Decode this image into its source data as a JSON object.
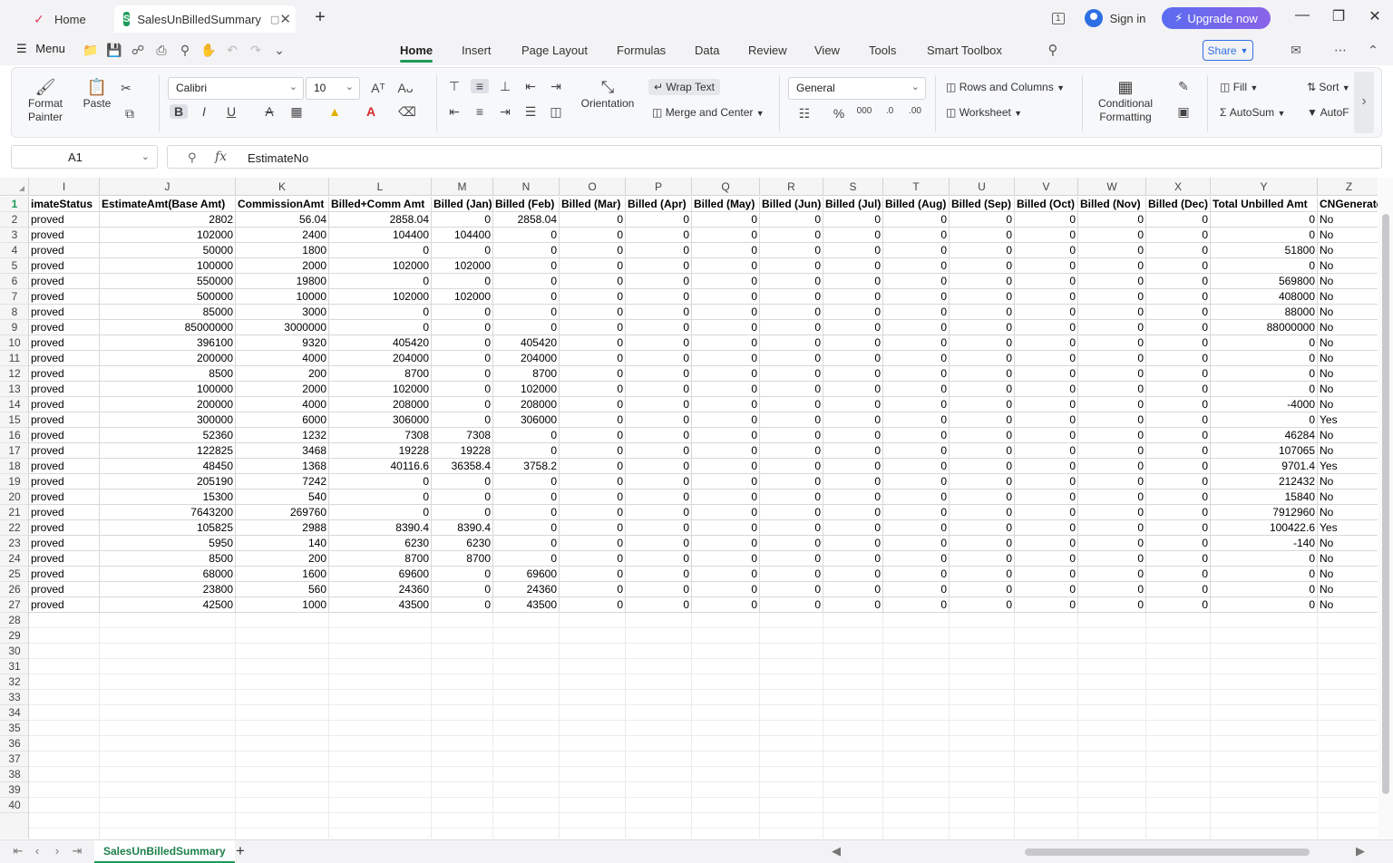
{
  "tabs": {
    "home_label": "Home",
    "doc_label": "SalesUnBilledSummary"
  },
  "titlebar": {
    "signin_label": "Sign in",
    "upgrade_label": "Upgrade now",
    "window_badge": "1"
  },
  "menubar": {
    "menu_label": "Menu",
    "ribbon_tabs": [
      "Home",
      "Insert",
      "Page Layout",
      "Formulas",
      "Data",
      "Review",
      "View",
      "Tools",
      "Smart Toolbox"
    ],
    "active_tab": "Home",
    "share_label": "Share"
  },
  "ribbon": {
    "format_painter": "Format Painter",
    "paste": "Paste",
    "font_name": "Calibri",
    "font_size": "10",
    "wrap_text": "Wrap Text",
    "orientation": "Orientation",
    "merge_center": "Merge and Center",
    "number_format": "General",
    "rows_columns": "Rows and Columns",
    "worksheet": "Worksheet",
    "conditional_formatting": "Conditional Formatting",
    "fill": "Fill",
    "sort": "Sort",
    "autosum": "AutoSum",
    "autofilter": "AutoF",
    "accent_color": "#1b9b58"
  },
  "formula_bar": {
    "cell_ref": "A1",
    "fx": "fx",
    "content": "EstimateNo"
  },
  "sheet": {
    "columns": [
      {
        "letter": "I",
        "header": "imateStatus",
        "type": "text"
      },
      {
        "letter": "J",
        "header": "EstimateAmt(Base Amt)",
        "type": "num"
      },
      {
        "letter": "K",
        "header": "CommissionAmt",
        "type": "num"
      },
      {
        "letter": "L",
        "header": "Billed+Comm Amt",
        "type": "num"
      },
      {
        "letter": "M",
        "header": "Billed (Jan)",
        "type": "num"
      },
      {
        "letter": "N",
        "header": "Billed (Feb)",
        "type": "num"
      },
      {
        "letter": "O",
        "header": "Billed (Mar)",
        "type": "num"
      },
      {
        "letter": "P",
        "header": "Billed (Apr)",
        "type": "num"
      },
      {
        "letter": "Q",
        "header": "Billed (May)",
        "type": "num"
      },
      {
        "letter": "R",
        "header": "Billed (Jun)",
        "type": "num"
      },
      {
        "letter": "S",
        "header": "Billed (Jul)",
        "type": "num"
      },
      {
        "letter": "T",
        "header": "Billed (Aug)",
        "type": "num"
      },
      {
        "letter": "U",
        "header": "Billed (Sep)",
        "type": "num"
      },
      {
        "letter": "V",
        "header": "Billed (Oct)",
        "type": "num"
      },
      {
        "letter": "W",
        "header": "Billed (Nov)",
        "type": "num"
      },
      {
        "letter": "X",
        "header": "Billed (Dec)",
        "type": "num"
      },
      {
        "letter": "Y",
        "header": "Total Unbilled Amt",
        "type": "num"
      },
      {
        "letter": "Z",
        "header": "CNGenerate",
        "type": "text"
      }
    ],
    "rows": [
      [
        "proved",
        "2802",
        "56.04",
        "2858.04",
        "0",
        "2858.04",
        "0",
        "0",
        "0",
        "0",
        "0",
        "0",
        "0",
        "0",
        "0",
        "0",
        "0",
        "No"
      ],
      [
        "proved",
        "102000",
        "2400",
        "104400",
        "104400",
        "0",
        "0",
        "0",
        "0",
        "0",
        "0",
        "0",
        "0",
        "0",
        "0",
        "0",
        "0",
        "No"
      ],
      [
        "proved",
        "50000",
        "1800",
        "0",
        "0",
        "0",
        "0",
        "0",
        "0",
        "0",
        "0",
        "0",
        "0",
        "0",
        "0",
        "0",
        "51800",
        "No"
      ],
      [
        "proved",
        "100000",
        "2000",
        "102000",
        "102000",
        "0",
        "0",
        "0",
        "0",
        "0",
        "0",
        "0",
        "0",
        "0",
        "0",
        "0",
        "0",
        "No"
      ],
      [
        "proved",
        "550000",
        "19800",
        "0",
        "0",
        "0",
        "0",
        "0",
        "0",
        "0",
        "0",
        "0",
        "0",
        "0",
        "0",
        "0",
        "569800",
        "No"
      ],
      [
        "proved",
        "500000",
        "10000",
        "102000",
        "102000",
        "0",
        "0",
        "0",
        "0",
        "0",
        "0",
        "0",
        "0",
        "0",
        "0",
        "0",
        "408000",
        "No"
      ],
      [
        "proved",
        "85000",
        "3000",
        "0",
        "0",
        "0",
        "0",
        "0",
        "0",
        "0",
        "0",
        "0",
        "0",
        "0",
        "0",
        "0",
        "88000",
        "No"
      ],
      [
        "proved",
        "85000000",
        "3000000",
        "0",
        "0",
        "0",
        "0",
        "0",
        "0",
        "0",
        "0",
        "0",
        "0",
        "0",
        "0",
        "0",
        "88000000",
        "No"
      ],
      [
        "proved",
        "396100",
        "9320",
        "405420",
        "0",
        "405420",
        "0",
        "0",
        "0",
        "0",
        "0",
        "0",
        "0",
        "0",
        "0",
        "0",
        "0",
        "No"
      ],
      [
        "proved",
        "200000",
        "4000",
        "204000",
        "0",
        "204000",
        "0",
        "0",
        "0",
        "0",
        "0",
        "0",
        "0",
        "0",
        "0",
        "0",
        "0",
        "No"
      ],
      [
        "proved",
        "8500",
        "200",
        "8700",
        "0",
        "8700",
        "0",
        "0",
        "0",
        "0",
        "0",
        "0",
        "0",
        "0",
        "0",
        "0",
        "0",
        "No"
      ],
      [
        "proved",
        "100000",
        "2000",
        "102000",
        "0",
        "102000",
        "0",
        "0",
        "0",
        "0",
        "0",
        "0",
        "0",
        "0",
        "0",
        "0",
        "0",
        "No"
      ],
      [
        "proved",
        "200000",
        "4000",
        "208000",
        "0",
        "208000",
        "0",
        "0",
        "0",
        "0",
        "0",
        "0",
        "0",
        "0",
        "0",
        "0",
        "-4000",
        "No"
      ],
      [
        "proved",
        "300000",
        "6000",
        "306000",
        "0",
        "306000",
        "0",
        "0",
        "0",
        "0",
        "0",
        "0",
        "0",
        "0",
        "0",
        "0",
        "0",
        "Yes"
      ],
      [
        "proved",
        "52360",
        "1232",
        "7308",
        "7308",
        "0",
        "0",
        "0",
        "0",
        "0",
        "0",
        "0",
        "0",
        "0",
        "0",
        "0",
        "46284",
        "No"
      ],
      [
        "proved",
        "122825",
        "3468",
        "19228",
        "19228",
        "0",
        "0",
        "0",
        "0",
        "0",
        "0",
        "0",
        "0",
        "0",
        "0",
        "0",
        "107065",
        "No"
      ],
      [
        "proved",
        "48450",
        "1368",
        "40116.6",
        "36358.4",
        "3758.2",
        "0",
        "0",
        "0",
        "0",
        "0",
        "0",
        "0",
        "0",
        "0",
        "0",
        "9701.4",
        "Yes"
      ],
      [
        "proved",
        "205190",
        "7242",
        "0",
        "0",
        "0",
        "0",
        "0",
        "0",
        "0",
        "0",
        "0",
        "0",
        "0",
        "0",
        "0",
        "212432",
        "No"
      ],
      [
        "proved",
        "15300",
        "540",
        "0",
        "0",
        "0",
        "0",
        "0",
        "0",
        "0",
        "0",
        "0",
        "0",
        "0",
        "0",
        "0",
        "15840",
        "No"
      ],
      [
        "proved",
        "7643200",
        "269760",
        "0",
        "0",
        "0",
        "0",
        "0",
        "0",
        "0",
        "0",
        "0",
        "0",
        "0",
        "0",
        "0",
        "7912960",
        "No"
      ],
      [
        "proved",
        "105825",
        "2988",
        "8390.4",
        "8390.4",
        "0",
        "0",
        "0",
        "0",
        "0",
        "0",
        "0",
        "0",
        "0",
        "0",
        "0",
        "100422.6",
        "Yes"
      ],
      [
        "proved",
        "5950",
        "140",
        "6230",
        "6230",
        "0",
        "0",
        "0",
        "0",
        "0",
        "0",
        "0",
        "0",
        "0",
        "0",
        "0",
        "-140",
        "No"
      ],
      [
        "proved",
        "8500",
        "200",
        "8700",
        "8700",
        "0",
        "0",
        "0",
        "0",
        "0",
        "0",
        "0",
        "0",
        "0",
        "0",
        "0",
        "0",
        "No"
      ],
      [
        "proved",
        "68000",
        "1600",
        "69600",
        "0",
        "69600",
        "0",
        "0",
        "0",
        "0",
        "0",
        "0",
        "0",
        "0",
        "0",
        "0",
        "0",
        "No"
      ],
      [
        "proved",
        "23800",
        "560",
        "24360",
        "0",
        "24360",
        "0",
        "0",
        "0",
        "0",
        "0",
        "0",
        "0",
        "0",
        "0",
        "0",
        "0",
        "No"
      ],
      [
        "proved",
        "42500",
        "1000",
        "43500",
        "0",
        "43500",
        "0",
        "0",
        "0",
        "0",
        "0",
        "0",
        "0",
        "0",
        "0",
        "0",
        "0",
        "No"
      ]
    ],
    "row_numbers": [
      "1",
      "2",
      "3",
      "4",
      "5",
      "6",
      "7",
      "8",
      "9",
      "10",
      "11",
      "12",
      "13",
      "14",
      "15",
      "16",
      "17",
      "18",
      "19",
      "20",
      "21",
      "22",
      "23",
      "24",
      "25",
      "26",
      "27",
      "28",
      "29",
      "30",
      "31",
      "32",
      "33",
      "34",
      "35",
      "36",
      "37",
      "38",
      "39",
      "40"
    ]
  },
  "sheetbar": {
    "active_sheet": "SalesUnBilledSummary"
  }
}
